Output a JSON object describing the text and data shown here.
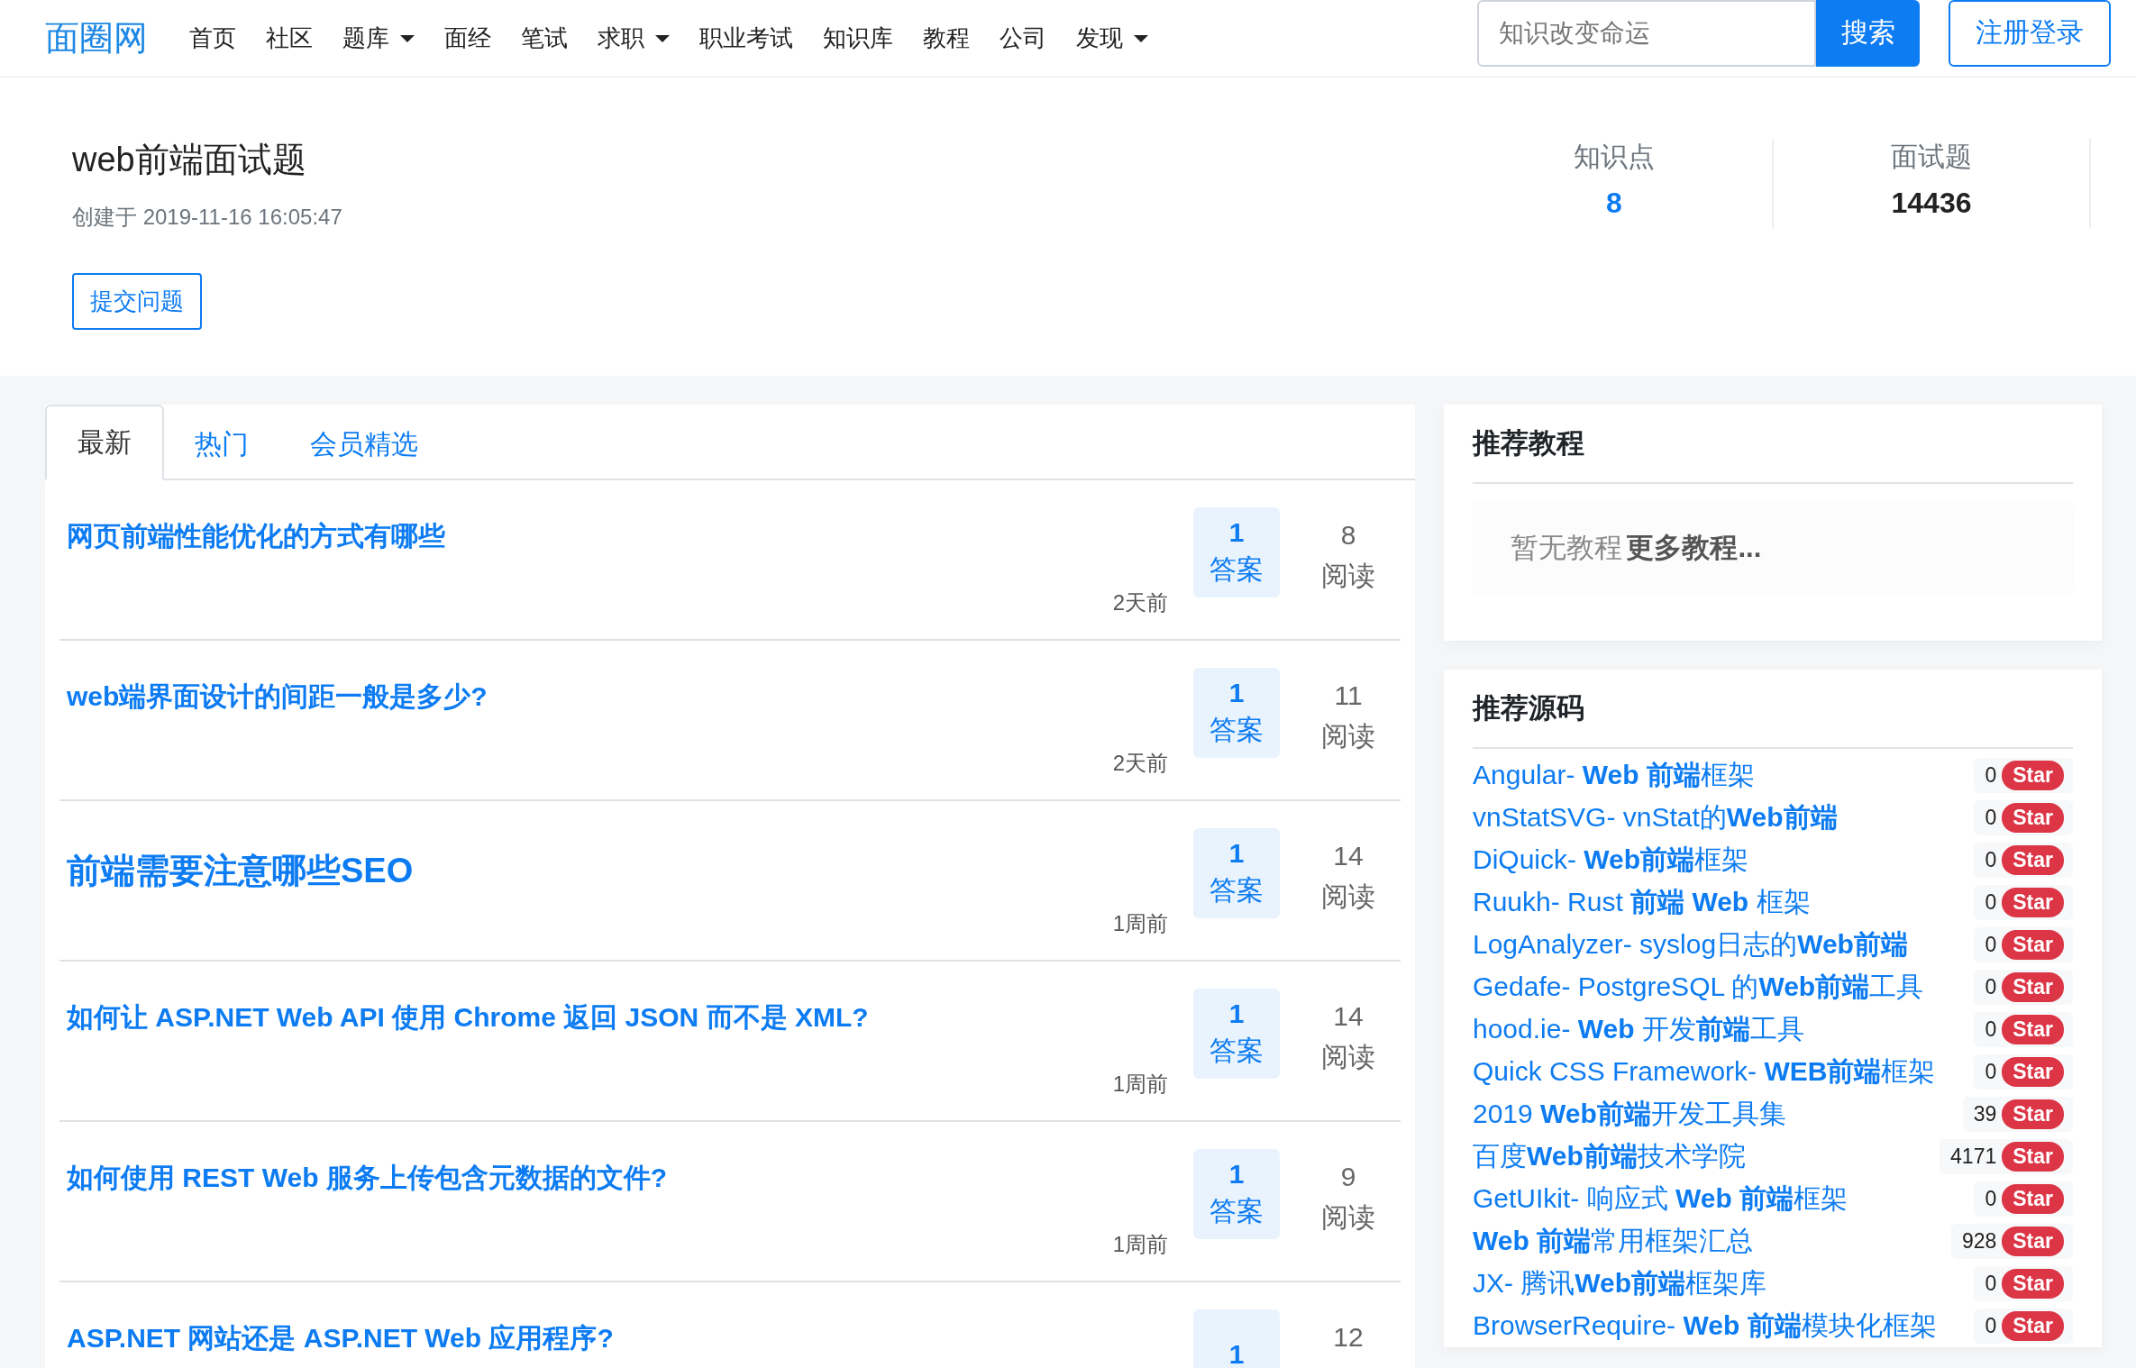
{
  "header": {
    "logo": "面圈网",
    "nav": [
      {
        "label": "首页",
        "dropdown": false
      },
      {
        "label": "社区",
        "dropdown": false
      },
      {
        "label": "题库",
        "dropdown": true
      },
      {
        "label": "面经",
        "dropdown": false
      },
      {
        "label": "笔试",
        "dropdown": false
      },
      {
        "label": "求职",
        "dropdown": true
      },
      {
        "label": "职业考试",
        "dropdown": false
      },
      {
        "label": "知识库",
        "dropdown": false
      },
      {
        "label": "教程",
        "dropdown": false
      },
      {
        "label": "公司",
        "dropdown": false
      },
      {
        "label": "发现",
        "dropdown": true
      }
    ],
    "search": {
      "placeholder": "知识改变命运",
      "button": "搜索"
    },
    "login": "注册登录"
  },
  "topic": {
    "title": "web前端面试题",
    "created": "创建于 2019-11-16 16:05:47",
    "submit": "提交问题",
    "stats": [
      {
        "label": "知识点",
        "value": "8",
        "link": true
      },
      {
        "label": "面试题",
        "value": "14436",
        "link": false
      }
    ]
  },
  "tabs": [
    {
      "label": "最新",
      "selected": true
    },
    {
      "label": "热门",
      "selected": false
    },
    {
      "label": "会员精选",
      "selected": false
    }
  ],
  "questions": [
    {
      "title": "网页前端性能优化的方式有哪些",
      "kind": "normal",
      "time": "2天前",
      "answers": "1",
      "answer_label": "答案",
      "reads": "8",
      "read_label": "阅读"
    },
    {
      "title": "web端界面设计的间距一般是多少?",
      "kind": "normal",
      "time": "2天前",
      "answers": "1",
      "answer_label": "答案",
      "reads": "11",
      "read_label": "阅读"
    },
    {
      "title": "前端需要注意哪些SEO",
      "kind": "large",
      "time": "1周前",
      "answers": "1",
      "answer_label": "答案",
      "reads": "14",
      "read_label": "阅读"
    },
    {
      "title": "如何让 ASP.NET Web API 使用 Chrome 返回 JSON 而不是 XML?",
      "kind": "normal",
      "time": "1周前",
      "answers": "1",
      "answer_label": "答案",
      "reads": "14",
      "read_label": "阅读"
    },
    {
      "title": "如何使用 REST Web 服务上传包含元数据的文件?",
      "kind": "normal",
      "time": "1周前",
      "answers": "1",
      "answer_label": "答案",
      "reads": "9",
      "read_label": "阅读"
    },
    {
      "title": "ASP.NET 网站还是 ASP.NET Web 应用程序?",
      "kind": "normal",
      "answers": "1",
      "reads": "12"
    }
  ],
  "tutorials": {
    "heading": "推荐教程",
    "empty": "暂无教程",
    "more": "更多教程..."
  },
  "sources": {
    "heading": "推荐源码",
    "items": [
      {
        "title": "Angular- **Web 前端**框架",
        "count": "0",
        "badge": "Star"
      },
      {
        "title": "vnStatSVG- vnStat的**Web前端**",
        "count": "0",
        "badge": "Star"
      },
      {
        "title": "DiQuick- **Web前端**框架",
        "count": "0",
        "badge": "Star"
      },
      {
        "title": "Ruukh- Rust **前端 Web** 框架",
        "count": "0",
        "badge": "Star"
      },
      {
        "title": "LogAnalyzer- syslog日志的**Web前端**",
        "count": "0",
        "badge": "Star"
      },
      {
        "title": "Gedafe- PostgreSQL 的**Web前端**工具",
        "count": "0",
        "badge": "Star"
      },
      {
        "title": "hood.ie- **Web** 开发**前端**工具",
        "count": "0",
        "badge": "Star"
      },
      {
        "title": "Quick CSS Framework- **WEB前端**框架",
        "count": "0",
        "badge": "Star"
      },
      {
        "title": "2019 **Web前端**开发工具集",
        "count": "39",
        "badge": "Star"
      },
      {
        "title": "百度**Web前端**技术学院",
        "count": "4171",
        "badge": "Star"
      },
      {
        "title": "GetUIkit- 响应式 **Web 前端**框架",
        "count": "0",
        "badge": "Star"
      },
      {
        "title": "**Web 前端**常用框架汇总",
        "count": "928",
        "badge": "Star"
      },
      {
        "title": "JX- 腾讯**Web前端**框架库",
        "count": "0",
        "badge": "Star"
      },
      {
        "title": "BrowserRequire- **Web 前端**模块化框架",
        "count": "0",
        "badge": "Star"
      }
    ]
  }
}
